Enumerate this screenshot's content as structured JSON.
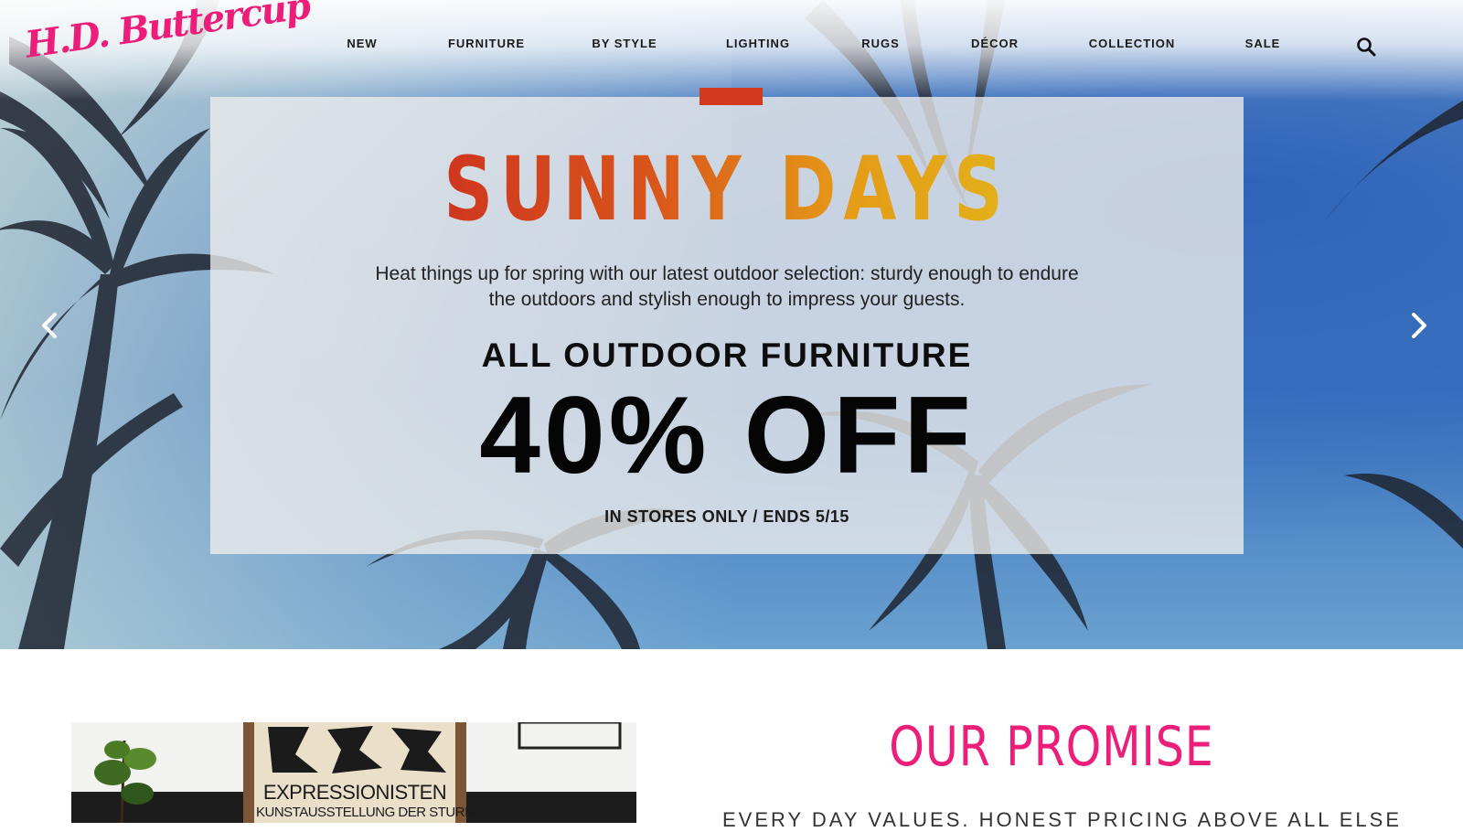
{
  "brand": {
    "logo_text": "H.D. Buttercup",
    "accent_color": "#ec1e79"
  },
  "nav": {
    "items": [
      {
        "label": "NEW"
      },
      {
        "label": "FURNITURE"
      },
      {
        "label": "BY STYLE"
      },
      {
        "label": "LIGHTING"
      },
      {
        "label": "RUGS"
      },
      {
        "label": "DÉCOR"
      },
      {
        "label": "COLLECTION"
      },
      {
        "label": "SALE"
      }
    ],
    "search_icon": "search-icon"
  },
  "hero": {
    "title": "SUNNY DAYS",
    "description": "Heat things up for spring with our latest outdoor selection: sturdy enough to endure the outdoors and stylish enough to impress your guests.",
    "subheading": "ALL OUTDOOR FURNITURE",
    "discount": "40% OFF",
    "note": "IN STORES ONLY / ENDS 5/15",
    "prev_icon": "chevron-left-icon",
    "next_icon": "chevron-right-icon",
    "title_gradient": [
      "#c9251f",
      "#e0c01c"
    ],
    "tab_color": "#d23a1c"
  },
  "feature_image": {
    "poster_title": "EXPRESSIONISTEN",
    "poster_subtitle": "KUNSTAUSSTELLUNG DER STURM"
  },
  "promise": {
    "title": "OUR PROMISE",
    "subtitle": "EVERY DAY VALUES. HONEST PRICING ABOVE ALL ELSE"
  }
}
